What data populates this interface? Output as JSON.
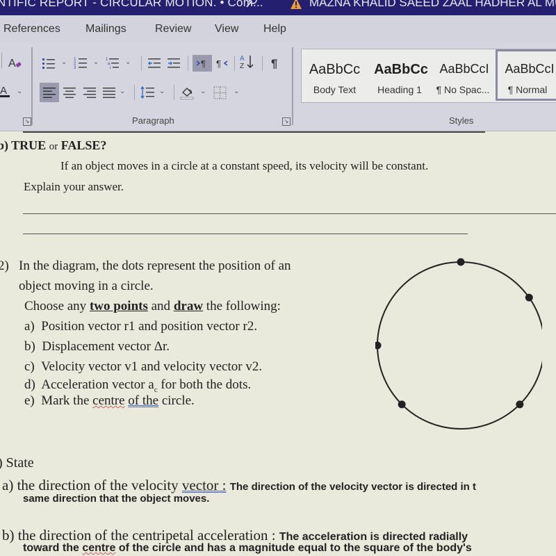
{
  "titlebar": {
    "doc_title": "NTIFIC REPORT - CIRCULAR MOTION. • Com...",
    "user_name": "MAZNA KHALID SAEED ZAAL HADHER AL MUHAIRI"
  },
  "tabs": [
    "References",
    "Mailings",
    "Review",
    "View",
    "Help"
  ],
  "ribbon": {
    "paragraph_group_label": "Paragraph",
    "styles_group_label": "Styles",
    "styles": [
      {
        "preview": "AaBbCc",
        "name": "Body Text"
      },
      {
        "preview": "AaBbCc",
        "name": "Heading 1"
      },
      {
        "preview": "AaBbCcI",
        "name": "¶ No Spac..."
      },
      {
        "preview": "AaBbCcI",
        "name": "¶ Normal"
      }
    ],
    "selected_style": "¶ Normal",
    "buttons": {
      "bullets": "bullets-icon",
      "numbering": "numbering-icon",
      "multilevel": "multilevel-list-icon",
      "decrease_indent": "decrease-indent-icon",
      "increase_indent": "increase-indent-icon",
      "ltr": "left-to-right-icon",
      "rtl": "right-to-left-icon",
      "sort": "sort-az-icon",
      "show_marks": "pilcrow-icon",
      "align_left": "align-left-icon",
      "align_center": "align-center-icon",
      "align_right": "align-right-icon",
      "justify": "justify-icon",
      "line_spacing": "line-spacing-icon",
      "shading": "shading-icon",
      "borders": "borders-icon"
    }
  },
  "document": {
    "q1": {
      "label": "b) TRUE",
      "or": "or",
      "false": "FALSE?",
      "statement": "If an object moves in a circle at a constant speed, its velocity will be constant.",
      "prompt": "Explain your answer."
    },
    "q2": {
      "number": "2)",
      "line1": "In the diagram, the dots represent the position of an",
      "line2": "object moving in a circle.",
      "choose_pre": "Choose any ",
      "choose_b1": "two points",
      "choose_mid": " and ",
      "choose_b2": "draw",
      "choose_post": " the following:",
      "items": [
        {
          "label": "a)",
          "text": "Position vector r1 and position vector r2."
        },
        {
          "label": "b)",
          "text": "Displacement vector Δr."
        },
        {
          "label": "c)",
          "text": "Velocity vector v1 and velocity vector v2."
        },
        {
          "label": "d)",
          "text_pre": "Acceleration vector a",
          "sub": "c",
          "text_post": " for both the dots."
        },
        {
          "label": "e)",
          "text_pre": "Mark the ",
          "spell": "centre",
          "mid": " ",
          "gram": "of  the",
          "text_post": " circle."
        }
      ],
      "diagram": {
        "dots_deg": [
          90,
          35,
          180,
          225,
          315
        ]
      }
    },
    "q3": {
      "label": ") State",
      "a_label": "a)",
      "a_q_pre": "the direction of the velocity ",
      "a_q_link": "vector :",
      "a_answer1": "The direction of the velocity vector is directed in t",
      "a_answer2": "same direction that the object moves.",
      "b_label": "b)",
      "b_q": "the direction of the centripetal acceleration :",
      "b_answer1": "The acceleration is directed radially",
      "b_answer2_pre": "toward the ",
      "b_answer2_spell": "centre",
      "b_answer2_post": " of the circle and has a magnitude equal to the square of the body's"
    }
  }
}
